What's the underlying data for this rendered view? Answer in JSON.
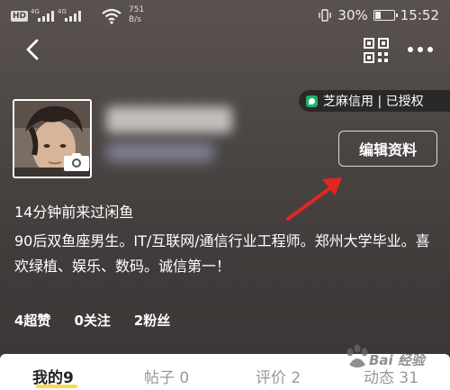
{
  "status_bar": {
    "hd_badge": "HD",
    "signal_tag": "4G",
    "speed_value": "751",
    "speed_unit": "B/s",
    "battery_percent": "30%",
    "battery_level": 0.3,
    "time": "15:52"
  },
  "nav": {
    "back_icon": "chevron-left-icon",
    "qr_icon": "qr-code-icon",
    "more_icon": "more-dots-icon"
  },
  "zhima": {
    "label": "芝麻信用 | 已授权"
  },
  "profile": {
    "edit_button": "编辑资料",
    "last_visit": "14分钟前来过闲鱼",
    "bio": "90后双鱼座男生。IT/互联网/通信行业工程师。郑州大学毕业。喜欢绿植、娱乐、数码。诚信第一！"
  },
  "stats": [
    {
      "label": "4超赞"
    },
    {
      "label": "0关注"
    },
    {
      "label": "2粉丝"
    }
  ],
  "tabs": [
    {
      "label": "我的9"
    },
    {
      "label": "帖子 0"
    },
    {
      "label": "评价 2"
    },
    {
      "label": "动态 31"
    }
  ],
  "watermark": {
    "text": "Bai 经验"
  },
  "colors": {
    "accent_underline": "#ffd84d",
    "zhima_green": "#1fb26b",
    "arrow_red": "#e3261f"
  }
}
